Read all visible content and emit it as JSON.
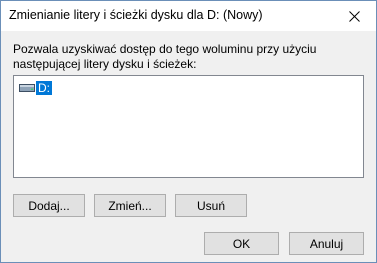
{
  "window": {
    "title": "Zmienianie litery i ścieżki dysku dla D: (Nowy)",
    "close_icon": "close-icon"
  },
  "prompt": "Pozwala uzyskiwać dostęp do tego woluminu przy użyciu następującej litery dysku i ścieżek:",
  "list": {
    "items": [
      {
        "label": "D:",
        "icon": "drive-icon",
        "selected": true
      }
    ]
  },
  "buttons": {
    "add": "Dodaj...",
    "change": "Zmień...",
    "remove": "Usuń",
    "ok": "OK",
    "cancel": "Anuluj"
  },
  "colors": {
    "selection": "#0078d7",
    "dialog_bg": "#f0f0f0",
    "button_bg": "#e1e1e1"
  }
}
